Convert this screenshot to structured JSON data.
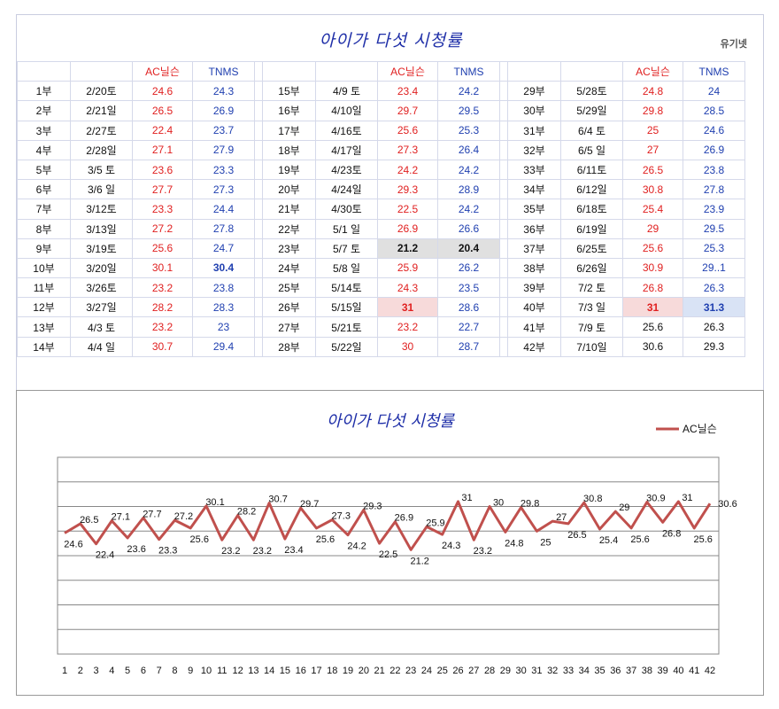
{
  "sheet": {
    "title": "아이가 다섯 시청률",
    "author": "유기넷",
    "headers": {
      "ac": "AC닐슨",
      "tnms": "TNMS"
    },
    "rows": [
      [
        {
          "ep": "1부",
          "date": "2/20토",
          "ac": "24.6",
          "tn": "24.3"
        },
        {
          "ep": "15부",
          "date": "4/9 토",
          "ac": "23.4",
          "tn": "24.2"
        },
        {
          "ep": "29부",
          "date": "5/28토",
          "ac": "24.8",
          "tn": "24"
        }
      ],
      [
        {
          "ep": "2부",
          "date": "2/21일",
          "ac": "26.5",
          "tn": "26.9"
        },
        {
          "ep": "16부",
          "date": "4/10일",
          "ac": "29.7",
          "tn": "29.5"
        },
        {
          "ep": "30부",
          "date": "5/29일",
          "ac": "29.8",
          "tn": "28.5"
        }
      ],
      [
        {
          "ep": "3부",
          "date": "2/27토",
          "ac": "22.4",
          "tn": "23.7"
        },
        {
          "ep": "17부",
          "date": "4/16토",
          "ac": "25.6",
          "tn": "25.3"
        },
        {
          "ep": "31부",
          "date": "6/4 토",
          "ac": "25",
          "tn": "24.6"
        }
      ],
      [
        {
          "ep": "4부",
          "date": "2/28일",
          "ac": "27.1",
          "tn": "27.9"
        },
        {
          "ep": "18부",
          "date": "4/17일",
          "ac": "27.3",
          "tn": "26.4"
        },
        {
          "ep": "32부",
          "date": "6/5 일",
          "ac": "27",
          "tn": "26.9"
        }
      ],
      [
        {
          "ep": "5부",
          "date": "3/5 토",
          "ac": "23.6",
          "tn": "23.3"
        },
        {
          "ep": "19부",
          "date": "4/23토",
          "ac": "24.2",
          "tn": "24.2"
        },
        {
          "ep": "33부",
          "date": "6/11토",
          "ac": "26.5",
          "tn": "23.8"
        }
      ],
      [
        {
          "ep": "6부",
          "date": "3/6 일",
          "ac": "27.7",
          "tn": "27.3"
        },
        {
          "ep": "20부",
          "date": "4/24일",
          "ac": "29.3",
          "tn": "28.9"
        },
        {
          "ep": "34부",
          "date": "6/12일",
          "ac": "30.8",
          "tn": "27.8"
        }
      ],
      [
        {
          "ep": "7부",
          "date": "3/12토",
          "ac": "23.3",
          "tn": "24.4"
        },
        {
          "ep": "21부",
          "date": "4/30토",
          "ac": "22.5",
          "tn": "24.2"
        },
        {
          "ep": "35부",
          "date": "6/18토",
          "ac": "25.4",
          "tn": "23.9"
        }
      ],
      [
        {
          "ep": "8부",
          "date": "3/13일",
          "ac": "27.2",
          "tn": "27.8"
        },
        {
          "ep": "22부",
          "date": "5/1 일",
          "ac": "26.9",
          "tn": "26.6"
        },
        {
          "ep": "36부",
          "date": "6/19일",
          "ac": "29",
          "tn": "29.5"
        }
      ],
      [
        {
          "ep": "9부",
          "date": "3/19토",
          "ac": "25.6",
          "tn": "24.7"
        },
        {
          "ep": "23부",
          "date": "5/7 토",
          "ac": "21.2",
          "tn": "20.4",
          "hl": "gray"
        },
        {
          "ep": "37부",
          "date": "6/25토",
          "ac": "25.6",
          "tn": "25.3"
        }
      ],
      [
        {
          "ep": "10부",
          "date": "3/20일",
          "ac": "30.1",
          "tn": "30.4",
          "tnbold": true
        },
        {
          "ep": "24부",
          "date": "5/8 일",
          "ac": "25.9",
          "tn": "26.2"
        },
        {
          "ep": "38부",
          "date": "6/26일",
          "ac": "30.9",
          "tn": "29..1"
        }
      ],
      [
        {
          "ep": "11부",
          "date": "3/26토",
          "ac": "23.2",
          "tn": "23.8"
        },
        {
          "ep": "25부",
          "date": "5/14토",
          "ac": "24.3",
          "tn": "23.5"
        },
        {
          "ep": "39부",
          "date": "7/2 토",
          "ac": "26.8",
          "tn": "26.3"
        }
      ],
      [
        {
          "ep": "12부",
          "date": "3/27일",
          "ac": "28.2",
          "tn": "28.3"
        },
        {
          "ep": "26부",
          "date": "5/15일",
          "ac": "31",
          "tn": "28.6",
          "acpink": true
        },
        {
          "ep": "40부",
          "date": "7/3 일",
          "ac": "31",
          "tn": "31.3",
          "acpink": true,
          "tnblue": true
        }
      ],
      [
        {
          "ep": "13부",
          "date": "4/3 토",
          "ac": "23.2",
          "tn": "23"
        },
        {
          "ep": "27부",
          "date": "5/21토",
          "ac": "23.2",
          "tn": "22.7"
        },
        {
          "ep": "41부",
          "date": "7/9 토",
          "ac": "25.6",
          "tn": "26.3",
          "black": true
        }
      ],
      [
        {
          "ep": "14부",
          "date": "4/4 일",
          "ac": "30.7",
          "tn": "29.4"
        },
        {
          "ep": "28부",
          "date": "5/22일",
          "ac": "30",
          "tn": "28.7"
        },
        {
          "ep": "42부",
          "date": "7/10일",
          "ac": "30.6",
          "tn": "29.3",
          "black": true
        }
      ]
    ]
  },
  "chart_data": {
    "type": "line",
    "title": "아이가 다섯 시청률",
    "x": [
      1,
      2,
      3,
      4,
      5,
      6,
      7,
      8,
      9,
      10,
      11,
      12,
      13,
      14,
      15,
      16,
      17,
      18,
      19,
      20,
      21,
      22,
      23,
      24,
      25,
      26,
      27,
      28,
      29,
      30,
      31,
      32,
      33,
      34,
      35,
      36,
      37,
      38,
      39,
      40,
      41,
      42
    ],
    "series": [
      {
        "name": "AC닐슨",
        "color": "#c0504d",
        "values": [
          24.6,
          26.5,
          22.4,
          27.1,
          23.6,
          27.7,
          23.3,
          27.2,
          25.6,
          30.1,
          23.2,
          28.2,
          23.2,
          30.7,
          23.4,
          29.7,
          25.6,
          27.3,
          24.2,
          29.3,
          22.5,
          26.9,
          21.2,
          25.9,
          24.3,
          31,
          23.2,
          30,
          24.8,
          29.8,
          25,
          27,
          26.5,
          30.8,
          25.4,
          29,
          25.6,
          30.9,
          26.8,
          31,
          25.6,
          30.6
        ]
      }
    ],
    "ylim": [
      0,
      40
    ],
    "grid": true,
    "legend": "top-right"
  }
}
